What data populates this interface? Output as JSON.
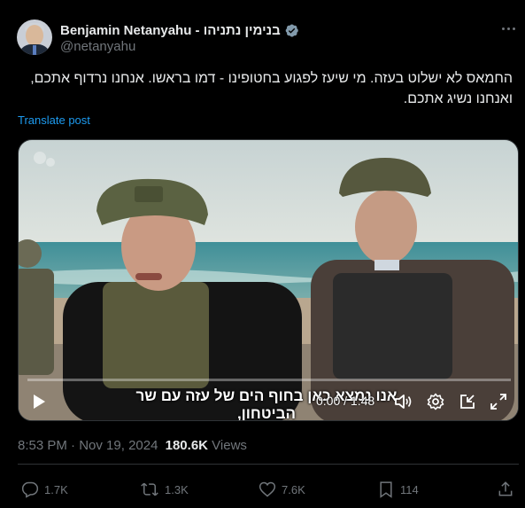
{
  "author": {
    "display_name": "Benjamin Netanyahu - בנימין נתניהו",
    "handle": "@netanyahu",
    "verified": true,
    "avatar_icon": "profile-photo"
  },
  "post": {
    "text": "החמאס לא ישלוט בעזה. מי שיעז לפגוע בחטופינו - דמו בראשו. אנחנו נרדוף אתכם, ואנחנו נשיג אתכם.",
    "translate_label": "Translate post"
  },
  "video": {
    "subtitle": "אנו נמצא כאן בחוף הים של עזה עם שר הביטחון,",
    "current_time": "0:00",
    "separator": " / ",
    "duration": "1:48",
    "progress": 0.0,
    "controls": [
      "play-icon",
      "volume-icon",
      "settings-icon",
      "pip-icon",
      "fullscreen-icon"
    ]
  },
  "meta": {
    "time": "8:53 PM",
    "dot": " · ",
    "date": "Nov 19, 2024",
    "views_count": "180.6K",
    "views_label": "Views"
  },
  "actions": {
    "replies": "1.7K",
    "reposts": "1.3K",
    "likes": "7.6K",
    "bookmarks": "114"
  },
  "colors": {
    "accent": "#1d9bf0",
    "muted": "#71767b",
    "text": "#e7e9ea",
    "background": "#000000"
  }
}
